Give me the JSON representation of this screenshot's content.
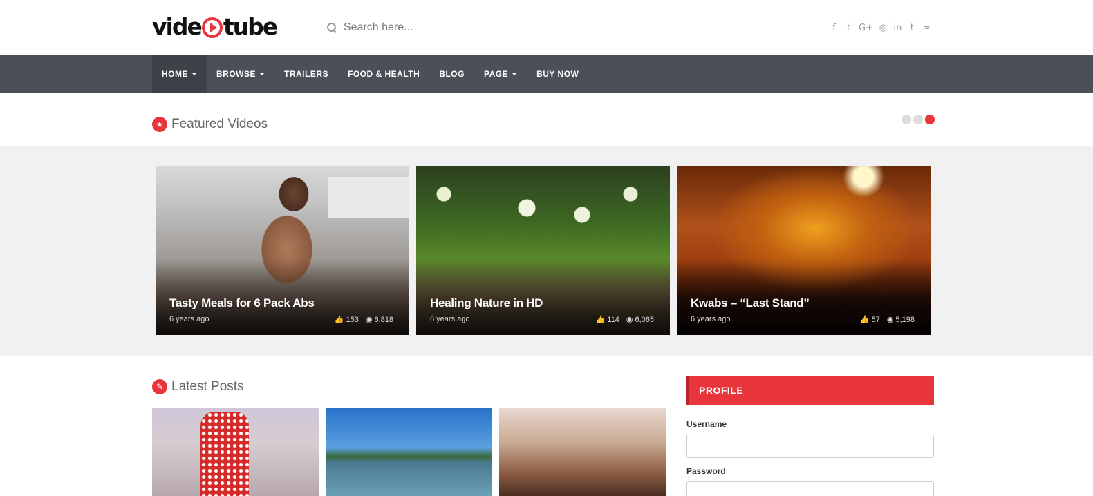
{
  "header": {
    "logo_text_left": "vide",
    "logo_text_right": "tube",
    "search_placeholder": "Search here...",
    "social_icons": [
      "facebook-icon",
      "twitter-icon",
      "google-plus-icon",
      "instagram-icon",
      "linkedin-icon",
      "tumblr-icon",
      "rss-icon"
    ],
    "social_glyphs": [
      "f",
      "t",
      "G+",
      "◎",
      "in",
      "t",
      "≈"
    ]
  },
  "nav": {
    "items": [
      {
        "label": "HOME",
        "dropdown": true,
        "active": true
      },
      {
        "label": "BROWSE",
        "dropdown": true
      },
      {
        "label": "TRAILERS"
      },
      {
        "label": "FOOD & HEALTH"
      },
      {
        "label": "BLOG"
      },
      {
        "label": "PAGE",
        "dropdown": true
      },
      {
        "label": "BUY NOW"
      }
    ]
  },
  "featured": {
    "title": "Featured Videos",
    "slide_count": 3,
    "active_slide": 3,
    "cards": [
      {
        "title": "Tasty Meals for 6 Pack Abs",
        "time": "6 years ago",
        "likes": "153",
        "views": "6,818"
      },
      {
        "title": "Healing Nature in HD",
        "time": "6 years ago",
        "likes": "114",
        "views": "6,065"
      },
      {
        "title": "Kwabs – “Last Stand”",
        "time": "6 years ago",
        "likes": "57",
        "views": "5,198"
      }
    ]
  },
  "latest": {
    "title": "Latest Posts"
  },
  "profile": {
    "heading": "PROFILE",
    "username_label": "Username",
    "password_label": "Password"
  },
  "colors": {
    "accent": "#e8343b",
    "nav_bg": "#4b5058",
    "featured_bg": "#f1f1f1"
  }
}
